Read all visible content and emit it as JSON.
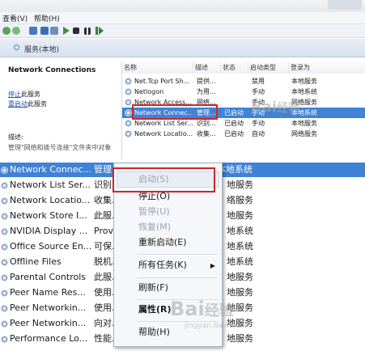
{
  "menubar": {
    "view": "查看(V)",
    "help": "帮助(H)"
  },
  "breadcrumb": "服务(本地)",
  "leftpane": {
    "title": "Network Connections",
    "stop_link": "停止",
    "stop_suffix": "此服务",
    "restart_link": "重启动",
    "restart_suffix": "此服务",
    "desc_label": "描述:",
    "desc_partial": "管理\"网络和拨号连接\"文件夹中对象"
  },
  "table": {
    "headers": [
      "名称",
      "描述",
      "状态",
      "启动类型",
      "登录为"
    ],
    "rows": [
      {
        "name": "Net.Tcp Port Sh...",
        "desc": "提供...",
        "status": "",
        "startup": "禁用",
        "logon": "本地服务"
      },
      {
        "name": "Netlogon",
        "desc": "为用...",
        "status": "",
        "startup": "手动",
        "logon": "本地系统"
      },
      {
        "name": "Network Access...",
        "desc": "网络...",
        "status": "",
        "startup": "手动",
        "logon": "网络服务"
      },
      {
        "name": "Network Connec...",
        "desc": "管理...",
        "status": "已启动",
        "startup": "手动",
        "logon": "本地系统"
      },
      {
        "name": "Network List Ser...",
        "desc": "识别...",
        "status": "已启动",
        "startup": "手动",
        "logon": "本地服务"
      },
      {
        "name": "Network Locatio...",
        "desc": "收集...",
        "status": "已启动",
        "startup": "自动",
        "logon": "网络服务"
      }
    ]
  },
  "bottom_list": [
    {
      "name": "Network Connec...",
      "desc": "管理...",
      "right": "本地系统"
    },
    {
      "name": "Network List Ser...",
      "desc": "识别...",
      "right": "地服务"
    },
    {
      "name": "Network Locatio...",
      "desc": "收集...",
      "right": "络服务"
    },
    {
      "name": "Network Store I...",
      "desc": "此服...",
      "right": "地服务"
    },
    {
      "name": "NVIDIA Display ...",
      "desc": "Prov...",
      "right": "地系统"
    },
    {
      "name": "Office Source En...",
      "desc": "可保...",
      "right": "地系统"
    },
    {
      "name": "Offline Files",
      "desc": "脱机...",
      "right": "地系统"
    },
    {
      "name": "Parental Controls",
      "desc": "此服...",
      "right": "地服务"
    },
    {
      "name": "Peer Name Res...",
      "desc": "使用...",
      "right": "地服务"
    },
    {
      "name": "Peer Networkin...",
      "desc": "使用...",
      "right": "地服务"
    },
    {
      "name": "Peer Networkin...",
      "desc": "向对...",
      "right": "地服务"
    },
    {
      "name": "Performance Lo...",
      "desc": "性能...",
      "right": "地服务"
    }
  ],
  "context_menu": {
    "start": "启动(S)",
    "stop": "停止(O)",
    "pause": "暂停(U)",
    "resume": "恢复(M)",
    "restart": "重新启动(E)",
    "all_tasks": "所有任务(K)",
    "refresh": "刷新(F)",
    "properties": "属性(R)",
    "help": "帮助(H)"
  },
  "watermark": {
    "brand": "Bai",
    "mark": "经验",
    "domain": "jingyan.baidu.com"
  },
  "colors": {
    "selection": "#3f82d6",
    "highlight_box": "#d0262b",
    "link": "#1f57b5"
  }
}
